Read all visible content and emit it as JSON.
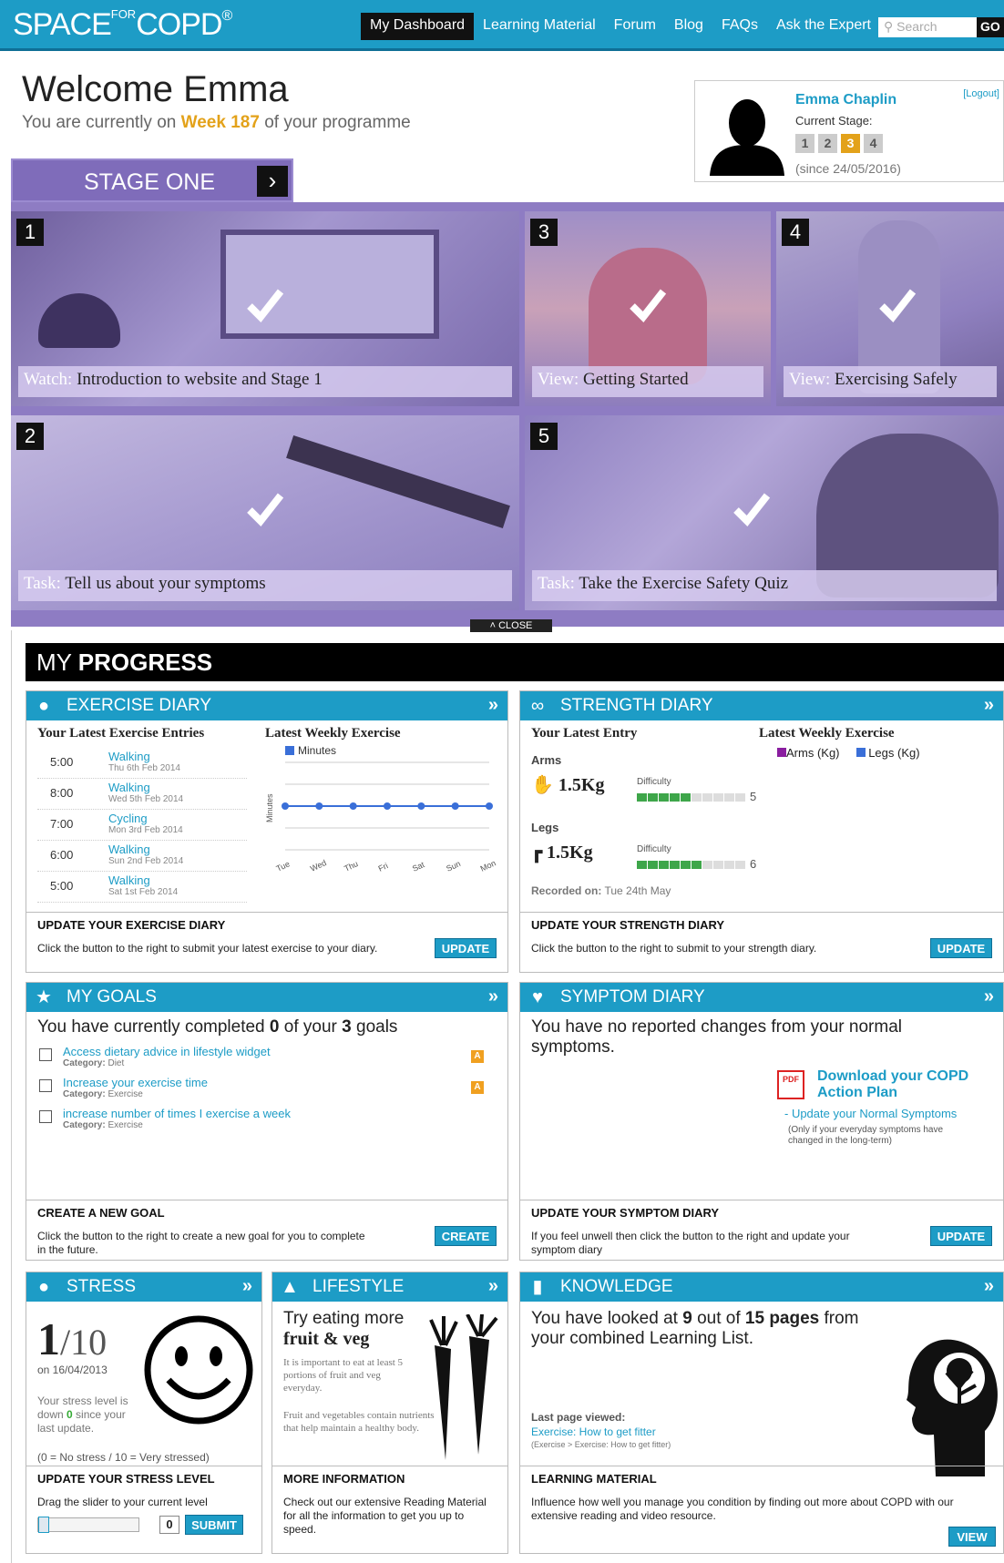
{
  "header": {
    "logo": "SPACE",
    "logo_for": "FOR",
    "logo_copd": "COPD",
    "logo_reg": "®",
    "nav": [
      "My Dashboard",
      "Learning Material",
      "Forum",
      "Blog",
      "FAQs",
      "Ask the Expert"
    ],
    "search_placeholder": "Search",
    "go_label": "GO"
  },
  "welcome": {
    "title": "Welcome Emma",
    "prefix": "You are currently on ",
    "week": "Week 187",
    "suffix": " of your programme"
  },
  "user": {
    "name": "Emma Chaplin",
    "logout": "[Logout]",
    "current_stage_label": "Current Stage:",
    "stages": [
      "1",
      "2",
      "3",
      "4"
    ],
    "active_stage": "3",
    "since": "(since 24/05/2016)"
  },
  "stage": {
    "tab_light": "STAGE ",
    "tab_bold": "ONE",
    "close_label": "CLOSE",
    "tiles": [
      {
        "num": "1",
        "kind": "Watch:",
        "text": "Introduction to website and Stage 1"
      },
      {
        "num": "3",
        "kind": "View:",
        "text": "Getting Started"
      },
      {
        "num": "4",
        "kind": "View:",
        "text": "Exercising Safely"
      },
      {
        "num": "2",
        "kind": "Task:",
        "text": "Tell us about your symptoms"
      },
      {
        "num": "5",
        "kind": "Task:",
        "text": "Take the Exercise Safety Quiz"
      }
    ]
  },
  "progress": {
    "title_light": "MY ",
    "title_bold": "PROGRESS",
    "more_icon": "»"
  },
  "exercise": {
    "title": "EXERCISE DIARY",
    "entries_heading": "Your Latest Exercise Entries",
    "chart_heading": "Latest Weekly Exercise",
    "entries": [
      {
        "time": "5:00",
        "activity": "Walking",
        "date": "Thu 6th Feb 2014"
      },
      {
        "time": "8:00",
        "activity": "Walking",
        "date": "Wed 5th Feb 2014"
      },
      {
        "time": "7:00",
        "activity": "Cycling",
        "date": "Mon 3rd Feb 2014"
      },
      {
        "time": "6:00",
        "activity": "Walking",
        "date": "Sun 2nd Feb 2014"
      },
      {
        "time": "5:00",
        "activity": "Walking",
        "date": "Sat 1st Feb 2014"
      }
    ],
    "foot_title": "UPDATE YOUR EXERCISE DIARY",
    "foot_desc": "Click the button to the right to submit your latest exercise to your diary.",
    "button": "UPDATE"
  },
  "chart_data": {
    "type": "line",
    "categories": [
      "Tue",
      "Wed",
      "Thu",
      "Fri",
      "Sat",
      "Sun",
      "Mon"
    ],
    "series": [
      {
        "name": "Minutes",
        "values": [
          0,
          0,
          0,
          0,
          0,
          0,
          0
        ]
      }
    ],
    "ylabel": "Minutes",
    "grid": true,
    "legend": "top",
    "color": "#3a6fd8"
  },
  "strength": {
    "title": "STRENGTH DIARY",
    "entry_heading": "Your Latest Entry",
    "chart_heading": "Latest Weekly Exercise",
    "legend_arms": "Arms (Kg)",
    "legend_legs": "Legs (Kg)",
    "arms_label": "Arms",
    "arms_value": "1.5Kg",
    "arms_difficulty": "5",
    "legs_label": "Legs",
    "legs_value": "1.5Kg",
    "legs_difficulty": "6",
    "difficulty_label": "Difficulty",
    "recorded_label": "Recorded on:",
    "recorded_date": "Tue 24th May",
    "foot_title": "UPDATE YOUR STRENGTH DIARY",
    "foot_desc": "Click the button to the right to submit to your strength diary.",
    "button": "UPDATE"
  },
  "goals": {
    "title": "MY GOALS",
    "summary_prefix": "You have currently completed ",
    "completed": "0",
    "summary_mid": " of your ",
    "total": "3",
    "summary_suffix": " goals",
    "category_label": "Category:",
    "items": [
      {
        "text": "Access dietary advice in lifestyle widget",
        "category": "Diet",
        "flag": "A"
      },
      {
        "text": "Increase your exercise time",
        "category": "Exercise",
        "flag": "A"
      },
      {
        "text": "increase number of times I exercise a week",
        "category": "Exercise",
        "flag": ""
      }
    ],
    "foot_title": "CREATE A NEW GOAL",
    "foot_desc": "Click the button to the right to create a new goal for you to complete in the future.",
    "button": "CREATE"
  },
  "symptom": {
    "title": "SYMPTOM DIARY",
    "message": "You have no reported changes from your normal symptoms.",
    "download": "Download your COPD Action Plan",
    "update_link": "- Update your Normal Symptoms",
    "note": "(Only if your everyday symptoms have changed in the long-term)",
    "foot_title": "UPDATE YOUR SYMPTOM DIARY",
    "foot_desc": "If you feel unwell then click the button to the right and update your symptom diary",
    "button": "UPDATE"
  },
  "stress": {
    "title": "STRESS",
    "value": "1",
    "max": "/10",
    "date": "on 16/04/2013",
    "down_prefix": "Your stress level is down ",
    "down_value": "0",
    "down_suffix": " since your last update.",
    "scale": "(0 = No stress / 10 = Very stressed)",
    "foot_title": "UPDATE YOUR STRESS LEVEL",
    "foot_desc": "Drag the slider to your current level",
    "slider_value": "0",
    "button": "SUBMIT"
  },
  "lifestyle": {
    "title": "LIFESTYLE",
    "tip_line1": "Try eating more",
    "tip_line2": "fruit & veg",
    "para1": "It is important to eat at least 5 portions of fruit and veg everyday.",
    "para2": "Fruit and vegetables contain nutrients that help maintain a healthy body.",
    "foot_title": "MORE INFORMATION",
    "foot_desc": "Check out our extensive Reading Material for all the information to get you up to speed."
  },
  "knowledge": {
    "title": "KNOWLEDGE",
    "summary_prefix": "You have looked at ",
    "viewed": "9",
    "summary_mid": " out of ",
    "total": "15 pages",
    "summary_suffix": " from your combined Learning List.",
    "last_label": "Last page viewed:",
    "last_link": "Exercise: How to get fitter",
    "last_path": "(Exercise > Exercise: How to get fitter)",
    "foot_title": "LEARNING MATERIAL",
    "foot_desc": "Influence how well you manage you condition by finding out more about COPD with our extensive reading and video resource.",
    "button": "VIEW"
  }
}
